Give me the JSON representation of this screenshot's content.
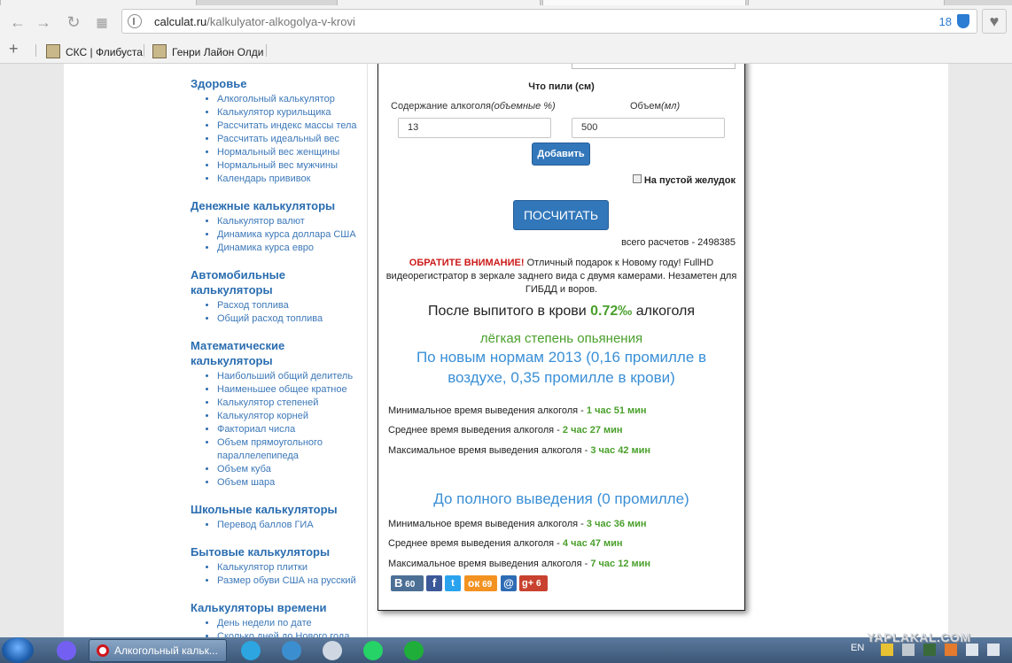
{
  "browser": {
    "url_host": "calculat.ru",
    "url_path": "/kalkulyator-alkogolya-v-krovi",
    "shield_count": "18",
    "bookmarks": [
      {
        "label": "СКС | Флибуста"
      },
      {
        "label": "Генри Лайон Олди"
      }
    ]
  },
  "sidebar": {
    "categories": [
      {
        "title": "Здоровье",
        "items": [
          "Алкогольный калькулятор",
          "Калькулятор курильщика",
          "Рассчитать индекс массы тела",
          "Рассчитать идеальный вес",
          "Нормальный вес женщины",
          "Нормальный вес мужчины",
          "Календарь прививок"
        ]
      },
      {
        "title": "Денежные калькуляторы",
        "items": [
          "Калькулятор валют",
          "Динамика курса доллара США",
          "Динамика курса евро"
        ]
      },
      {
        "title": "Автомобильные калькуляторы",
        "items": [
          "Расход топлива",
          "Общий расход топлива"
        ]
      },
      {
        "title": "Математические калькуляторы",
        "items": [
          "Наибольший общий делитель",
          "Наименьшее общее кратное",
          "Калькулятор степеней",
          "Калькулятор корней",
          "Факториал числа",
          "Объем прямоугольного параллелепипеда",
          "Объем куба",
          "Объем шара"
        ]
      },
      {
        "title": "Школьные калькуляторы",
        "items": [
          "Перевод баллов ГИА"
        ]
      },
      {
        "title": "Бытовые калькуляторы",
        "items": [
          "Калькулятор плитки",
          "Размер обуви США на русский"
        ]
      },
      {
        "title": "Калькуляторы времени",
        "items": [
          "День недели по дате",
          "Сколько дней до Нового года"
        ]
      }
    ]
  },
  "calc": {
    "what_drank": "Что пили (см)",
    "alcohol_label": "Содержание алкоголя",
    "alcohol_label_em": "(объемные %)",
    "volume_label": "Объем",
    "volume_label_em": "(мл)",
    "alcohol_value": "13",
    "volume_value": "500",
    "add_button": "Добавить",
    "empty_stomach": "На пустой желудок",
    "calc_button": "ПОСЧИТАТЬ",
    "total": "всего расчетов - 2498385",
    "notice_attn": "ОБРАТИТЕ ВНИМАНИЕ!",
    "notice_text": " Отличный подарок к Новому году! FullHD видеорегистратор в зеркале заднего вида с двумя камерами. Незаметен для ГИБДД и воров.",
    "result_pre": "После выпитого в крови ",
    "result_value": "0.72‰",
    "result_post": " алкоголя",
    "degree": "лёгкая степень опьянения",
    "norm_2013": "По новым нормам 2013 (0,16 промилле в воздухе, 0,35 промилле в крови)",
    "norm_2013_times": [
      {
        "label": "Минимальное время выведения алкоголя - ",
        "time": "1 час 51 мин"
      },
      {
        "label": "Среднее время выведения алкоголя - ",
        "time": "2 час 27 мин"
      },
      {
        "label": "Максимальное время выведения алкоголя - ",
        "time": "3 час 42 мин"
      }
    ],
    "full_head": "До полного выведения (0 промилле)",
    "full_times": [
      {
        "label": "Минимальное время выведения алкоголя - ",
        "time": "3 час 36 мин"
      },
      {
        "label": "Среднее время выведения алкоголя - ",
        "time": "4 час 47 мин"
      },
      {
        "label": "Максимальное время выведения алкоголя - ",
        "time": "7 час 12 мин"
      }
    ],
    "share": {
      "vk": "60",
      "ok": "69",
      "gplus": "6"
    }
  },
  "taskbar": {
    "task_title": "Алкогольный кальк...",
    "lang": "EN",
    "watermark": "YAPLAKAL.COM"
  },
  "colors": {
    "link": "#2a6db0",
    "accent_green": "#4aa02c",
    "button_blue": "#3277ba",
    "attention_red": "#cc1a1a"
  }
}
